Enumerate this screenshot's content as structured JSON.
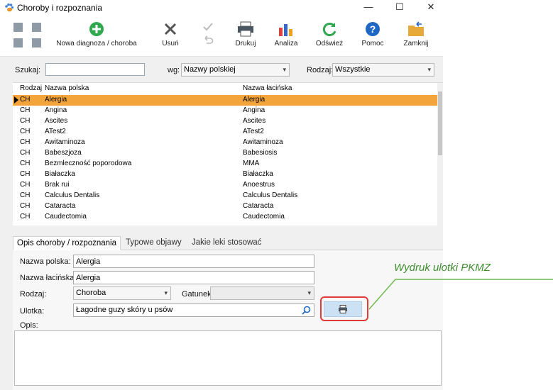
{
  "window": {
    "title": "Choroby i rozpoznania",
    "min": "—",
    "max": "☐",
    "close": "✕"
  },
  "toolbar": {
    "new_label": "Nowa diagnoza / choroba",
    "delete_label": "Usuń",
    "print_label": "Drukuj",
    "analysis_label": "Analiza",
    "refresh_label": "Odśwież",
    "help_label": "Pomoc",
    "close_label": "Zamknij"
  },
  "search": {
    "label": "Szukaj:",
    "value": "",
    "by_label": "wg:",
    "by_value": "Nazwy polskiej",
    "type_label": "Rodzaj:",
    "type_value": "Wszystkie"
  },
  "grid": {
    "columns": [
      "Rodzaj",
      "Nazwa polska",
      "Nazwa łacińska"
    ],
    "rows": [
      [
        "CH",
        "Alergia",
        "Alergia"
      ],
      [
        "CH",
        "Angina",
        "Angina"
      ],
      [
        "CH",
        "Ascites",
        "Ascites"
      ],
      [
        "CH",
        "ATest2",
        "ATest2"
      ],
      [
        "CH",
        "Awitaminoza",
        "Awitaminoza"
      ],
      [
        "CH",
        "Babeszjoza",
        "Babesiosis"
      ],
      [
        "CH",
        "Bezmleczność poporodowa",
        "MMA"
      ],
      [
        "CH",
        "Białaczka",
        "Białaczka"
      ],
      [
        "CH",
        "Brak rui",
        "Anoestrus"
      ],
      [
        "CH",
        "Calculus Dentalis",
        "Calculus Dentalis"
      ],
      [
        "CH",
        "Cataracta",
        "Cataracta"
      ],
      [
        "CH",
        "Caudectomia",
        "Caudectomia"
      ]
    ],
    "selected_index": 0
  },
  "tabs": [
    "Opis choroby / rozpoznania",
    "Typowe objawy",
    "Jakie leki stosować"
  ],
  "form": {
    "name_pl_label": "Nazwa polska:",
    "name_pl": "Alergia",
    "name_lat_label": "Nazwa łacińska:",
    "name_lat": "Alergia",
    "type_label": "Rodzaj:",
    "type_value": "Choroba",
    "species_label": "Gatunek:",
    "species_value": "",
    "leaflet_label": "Ulotka:",
    "leaflet_value": "Łagodne guzy skóry u psów",
    "desc_label": "Opis:",
    "desc_value": ""
  },
  "annotation": {
    "text": "Wydruk ulotki PKMZ",
    "color": "#3f8f2f"
  }
}
